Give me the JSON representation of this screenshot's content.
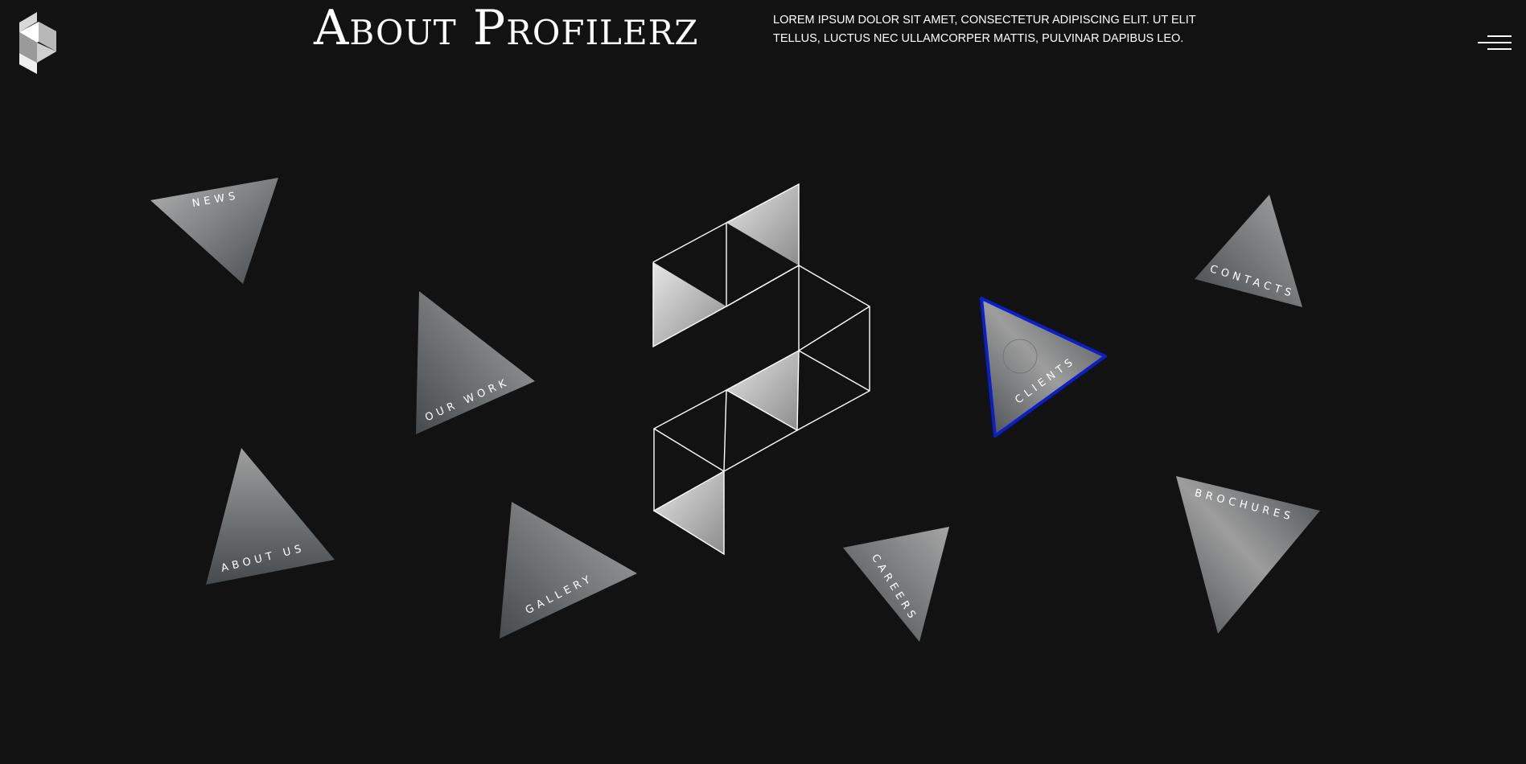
{
  "header": {
    "title": "About Profilerz",
    "intro": "Lorem ipsum dolor sit amet, consectetur adipiscing elit. Ut elit tellus, luctus nec ullamcorper mattis, pulvinar dapibus leo."
  },
  "nav": {
    "news": "NEWS",
    "our_work": "OUR WORK",
    "about_us": "ABOUT US",
    "gallery": "GALLERY",
    "careers": "CAREERS",
    "clients": "CLIENTS",
    "contacts": "CONTACTS",
    "brochures": "BROCHURES"
  },
  "icons": {
    "logo": "profilerz-logo-icon",
    "menu": "hamburger-menu-icon",
    "center": "profilerz-wireframe-logo"
  },
  "colors": {
    "background": "#121212",
    "text": "#ffffff",
    "focus_outline": "#0b1fc9"
  }
}
